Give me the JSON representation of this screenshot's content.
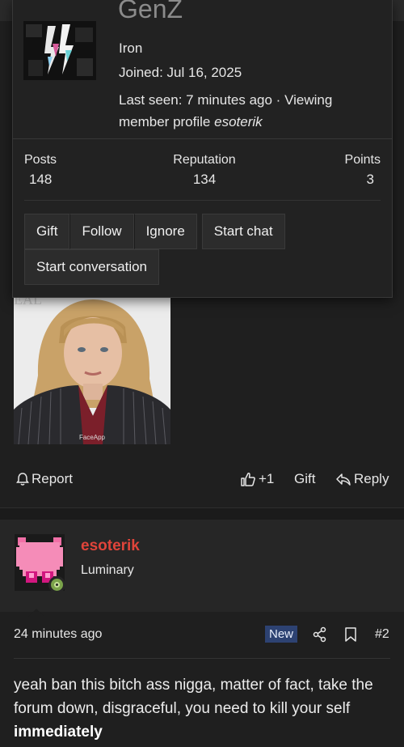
{
  "popup": {
    "username": "GenZ",
    "member_title": "Iron",
    "joined": "Joined: Jul 16, 2025",
    "last_seen_prefix": "Last seen: 7 minutes ago · Viewing member profile ",
    "last_seen_user": "esoterik",
    "stats": {
      "posts_label": "Posts",
      "posts_value": "148",
      "reputation_label": "Reputation",
      "reputation_value": "134",
      "points_label": "Points",
      "points_value": "3"
    },
    "buttons": {
      "gift": "Gift",
      "follow": "Follow",
      "ignore": "Ignore",
      "start_chat": "Start chat",
      "start_conversation": "Start conversation"
    }
  },
  "post_image": {
    "watermark": "FaceApp",
    "sign_text": "EAL"
  },
  "post_actions": {
    "report": "Report",
    "like": "+1",
    "gift": "Gift",
    "reply": "Reply"
  },
  "next_post": {
    "author": "esoterik",
    "rank": "Luminary",
    "time": "24 minutes ago",
    "badge": "New",
    "number": "#2",
    "body_text": "yeah ban this bitch ass nigga, matter of fact, take the forum down, disgraceful, you need to kill your self ",
    "body_bold": "immediately"
  },
  "colors": {
    "author": "#e0443a",
    "badge_bg": "#2d4272",
    "online": "#7aa34a"
  }
}
